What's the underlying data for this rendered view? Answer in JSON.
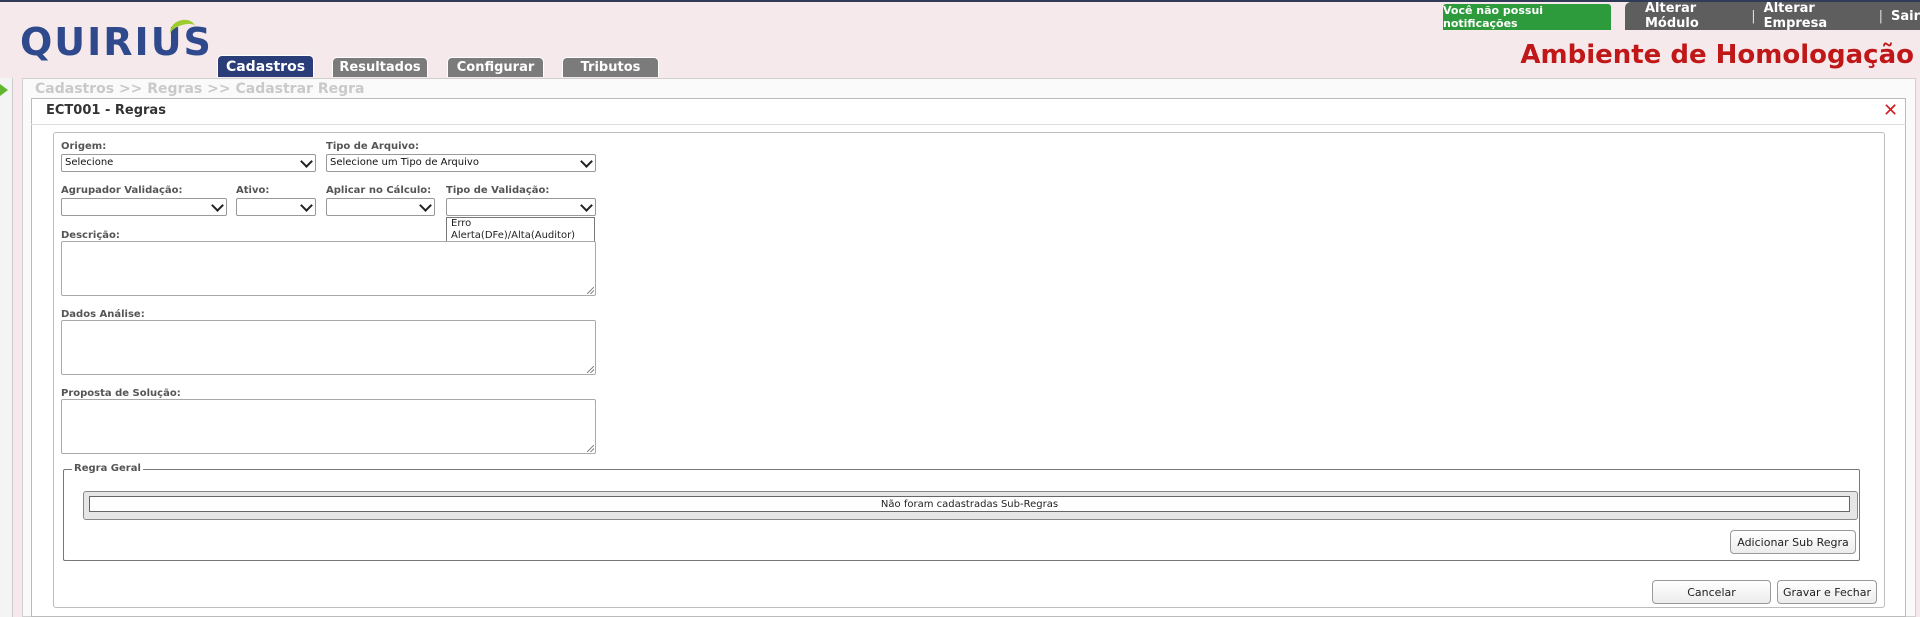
{
  "header": {
    "logo_text": "QUIRIUS",
    "notification": "Você não possui notificações",
    "menu": [
      "Alterar Módulo",
      "Alterar Empresa",
      "Sair"
    ],
    "environment": "Ambiente de Homologação",
    "tabs": [
      {
        "label": "Cadastros",
        "active": true
      },
      {
        "label": "Resultados",
        "active": false
      },
      {
        "label": "Configurar",
        "active": false
      },
      {
        "label": "Tributos",
        "active": false
      }
    ]
  },
  "breadcrumb": "Cadastros >> Regras >> Cadastrar Regra",
  "window": {
    "title": "ECT001 - Regras",
    "close_glyph": "✕"
  },
  "form": {
    "origem": {
      "label": "Origem:",
      "value": "Selecione"
    },
    "tipo_arquivo": {
      "label": "Tipo de Arquivo:",
      "value": "Selecione um Tipo de Arquivo"
    },
    "agrupador": {
      "label": "Agrupador Validação:",
      "value": ""
    },
    "ativo": {
      "label": "Ativo:",
      "value": ""
    },
    "aplicar_calculo": {
      "label": "Aplicar no Cálculo:",
      "value": ""
    },
    "tipo_validacao": {
      "label": "Tipo de Validação:",
      "value": "",
      "options": [
        "Erro",
        "Alerta(DFe)/Alta(Auditor)",
        ""
      ]
    },
    "descricao": {
      "label": "Descrição:"
    },
    "dados_analise": {
      "label": "Dados Análise:"
    },
    "proposta_solucao": {
      "label": "Proposta de Solução:"
    }
  },
  "regra_geral": {
    "legend": "Regra Geral",
    "empty_message": "Não foram cadastradas Sub-Regras",
    "add_button": "Adicionar Sub Regra"
  },
  "footer": {
    "cancel": "Cancelar",
    "save_close": "Gravar e Fechar"
  },
  "colors": {
    "brand_blue": "#2f4a8c",
    "active_tab": "#2a3d78",
    "notification_green": "#2d9a3c",
    "environment_red": "#c01818",
    "highlight": "#1e90ff"
  }
}
